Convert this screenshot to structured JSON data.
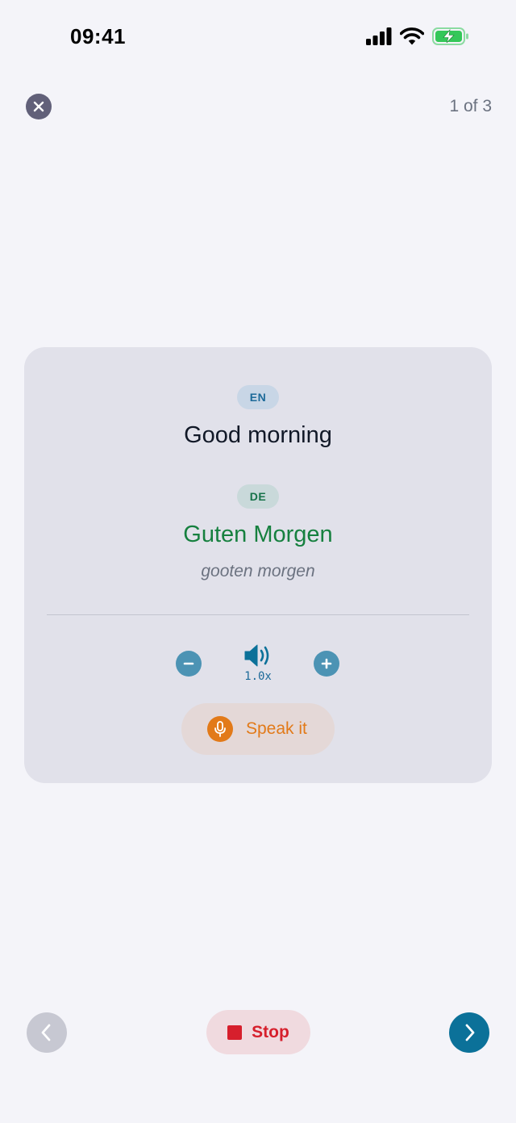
{
  "status_bar": {
    "time": "09:41",
    "icons": [
      "signal-icon",
      "wifi-icon",
      "battery-charging-icon"
    ]
  },
  "header": {
    "close_icon": "close-icon",
    "progress": "1 of 3"
  },
  "card": {
    "source": {
      "lang_code": "EN",
      "phrase": "Good morning"
    },
    "target": {
      "lang_code": "DE",
      "phrase": "Guten Morgen",
      "pronunciation": "gooten morgen"
    },
    "playback": {
      "speed": "1.0x",
      "icons": [
        "minus-icon",
        "speaker-icon",
        "plus-icon"
      ]
    },
    "speak_button": {
      "label": "Speak it",
      "icon": "microphone-icon"
    }
  },
  "footer": {
    "prev_icon": "chevron-left-icon",
    "stop_label": "Stop",
    "stop_icon": "stop-icon",
    "next_icon": "chevron-right-icon"
  },
  "colors": {
    "background": "#f4f4f9",
    "card": "#e1e1ea",
    "accent_blue": "#0b7199",
    "accent_green": "#16803f",
    "accent_orange": "#e27a19",
    "stop_red": "#d61f2c",
    "battery_green": "#34c759"
  }
}
